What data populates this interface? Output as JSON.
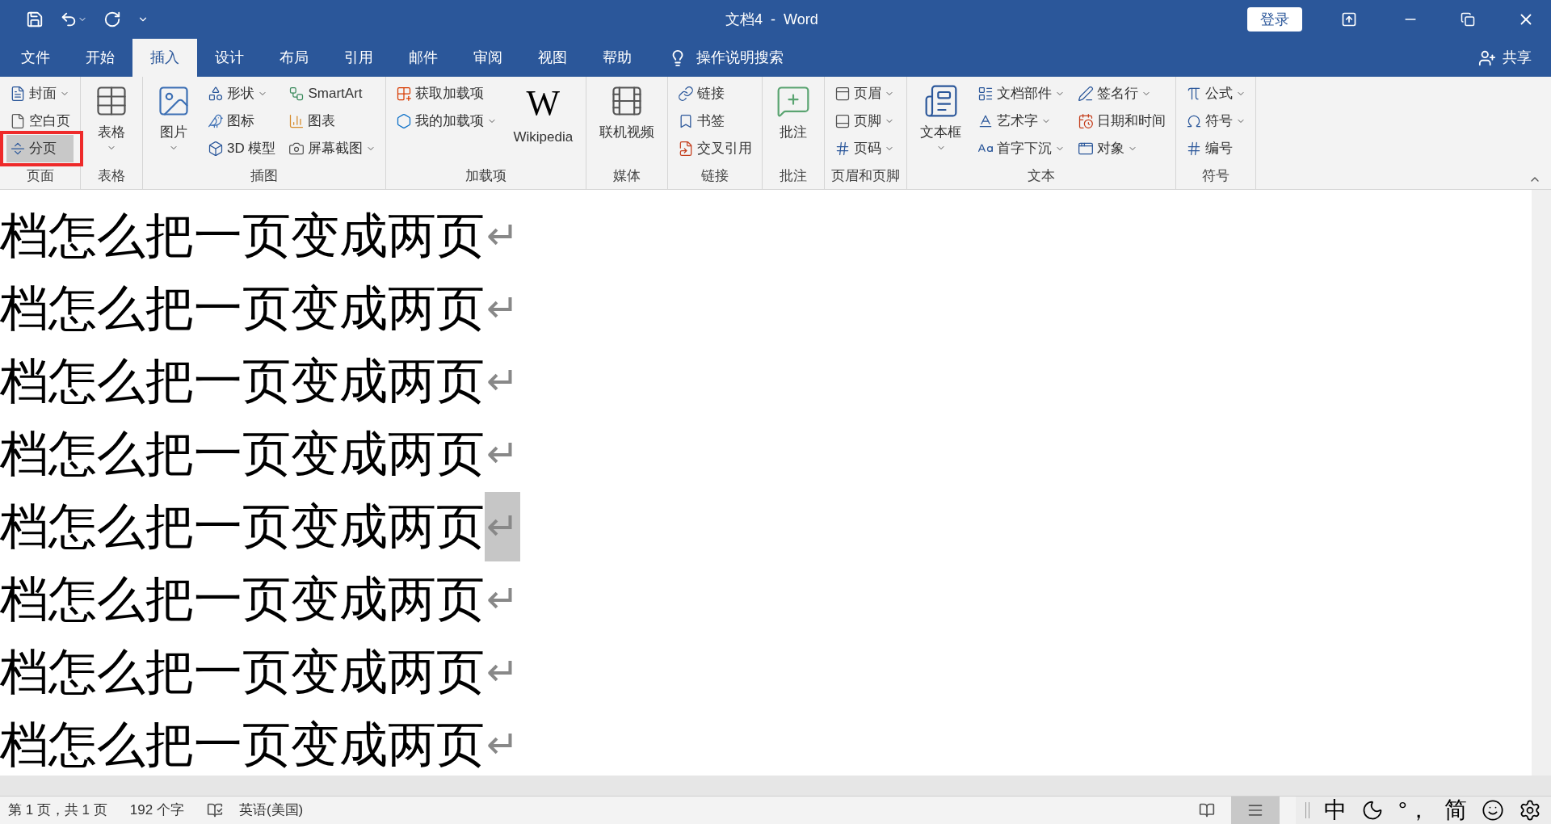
{
  "title_bar": {
    "title": "文档4  -  Word",
    "login": "登录"
  },
  "tabs": [
    {
      "label": "文件",
      "selected": false
    },
    {
      "label": "开始",
      "selected": false
    },
    {
      "label": "插入",
      "selected": true
    },
    {
      "label": "设计",
      "selected": false
    },
    {
      "label": "布局",
      "selected": false
    },
    {
      "label": "引用",
      "selected": false
    },
    {
      "label": "邮件",
      "selected": false
    },
    {
      "label": "审阅",
      "selected": false
    },
    {
      "label": "视图",
      "selected": false
    },
    {
      "label": "帮助",
      "selected": false
    }
  ],
  "tell_me": "操作说明搜索",
  "share": "共享",
  "ribbon": [
    {
      "label": "页面",
      "highlighted": true,
      "columns": [
        [
          {
            "label": "封面",
            "kind": "small",
            "dropdown": true,
            "selected": false
          },
          {
            "label": "空白页",
            "kind": "small",
            "dropdown": false,
            "selected": false
          },
          {
            "label": "分页",
            "kind": "small",
            "dropdown": false,
            "selected": true
          }
        ]
      ]
    },
    {
      "label": "表格",
      "columns": [
        [
          {
            "label": "表格",
            "kind": "large",
            "dropdown": true,
            "selected": false
          }
        ]
      ]
    },
    {
      "label": "插图",
      "columns": [
        [
          {
            "label": "图片",
            "kind": "large",
            "dropdown": true,
            "selected": false
          }
        ],
        [
          {
            "label": "形状",
            "kind": "small",
            "dropdown": true,
            "selected": false
          },
          {
            "label": "图标",
            "kind": "small",
            "dropdown": false,
            "selected": false
          },
          {
            "label": "3D 模型",
            "kind": "small",
            "dropdown": false,
            "selected": false
          }
        ],
        [
          {
            "label": "SmartArt",
            "kind": "small",
            "dropdown": false,
            "selected": false
          },
          {
            "label": "图表",
            "kind": "small",
            "dropdown": false,
            "selected": false
          },
          {
            "label": "屏幕截图",
            "kind": "small",
            "dropdown": true,
            "selected": false
          }
        ]
      ]
    },
    {
      "label": "加载项",
      "columns": [
        [
          {
            "label": "获取加载项",
            "kind": "small",
            "dropdown": false,
            "selected": false
          },
          {
            "label": "我的加载项",
            "kind": "small",
            "dropdown": true,
            "selected": false
          }
        ],
        [
          {
            "label": "Wikipedia",
            "kind": "logo",
            "glyph": "W",
            "dropdown": false,
            "selected": false
          }
        ]
      ]
    },
    {
      "label": "媒体",
      "columns": [
        [
          {
            "label": "联机视频",
            "kind": "large",
            "dropdown": false,
            "selected": false
          }
        ]
      ]
    },
    {
      "label": "链接",
      "columns": [
        [
          {
            "label": "链接",
            "kind": "small",
            "dropdown": false,
            "selected": false
          },
          {
            "label": "书签",
            "kind": "small",
            "dropdown": false,
            "selected": false
          },
          {
            "label": "交叉引用",
            "kind": "small",
            "dropdown": false,
            "selected": false
          }
        ]
      ]
    },
    {
      "label": "批注",
      "columns": [
        [
          {
            "label": "批注",
            "kind": "large",
            "dropdown": false,
            "selected": false
          }
        ]
      ]
    },
    {
      "label": "页眉和页脚",
      "columns": [
        [
          {
            "label": "页眉",
            "kind": "small",
            "dropdown": true,
            "selected": false
          },
          {
            "label": "页脚",
            "kind": "small",
            "dropdown": true,
            "selected": false
          },
          {
            "label": "页码",
            "kind": "small",
            "dropdown": true,
            "selected": false
          }
        ]
      ]
    },
    {
      "label": "文本",
      "columns": [
        [
          {
            "label": "文本框",
            "kind": "large",
            "dropdown": true,
            "selected": false
          }
        ],
        [
          {
            "label": "文档部件",
            "kind": "small",
            "dropdown": true,
            "selected": false
          },
          {
            "label": "艺术字",
            "kind": "small",
            "dropdown": true,
            "selected": false
          },
          {
            "label": "首字下沉",
            "kind": "small",
            "dropdown": true,
            "selected": false
          }
        ],
        [
          {
            "label": "签名行",
            "kind": "small",
            "dropdown": true,
            "selected": false
          },
          {
            "label": "日期和时间",
            "kind": "small",
            "dropdown": false,
            "selected": false
          },
          {
            "label": "对象",
            "kind": "small",
            "dropdown": true,
            "selected": false
          }
        ]
      ]
    },
    {
      "label": "符号",
      "columns": [
        [
          {
            "label": "公式",
            "kind": "small",
            "dropdown": true,
            "selected": false
          },
          {
            "label": "符号",
            "kind": "small",
            "dropdown": true,
            "selected": false
          },
          {
            "label": "编号",
            "kind": "small",
            "dropdown": false,
            "selected": false
          }
        ]
      ]
    }
  ],
  "document": [
    {
      "text": "档怎么把一页变成两页",
      "mark": "↵",
      "selected": false
    },
    {
      "text": "档怎么把一页变成两页",
      "mark": "↵",
      "selected": false
    },
    {
      "text": "档怎么把一页变成两页",
      "mark": "↵",
      "selected": false
    },
    {
      "text": "档怎么把一页变成两页",
      "mark": "↵",
      "selected": false
    },
    {
      "text": "档怎么把一页变成两页",
      "mark": "↵",
      "selected": true
    },
    {
      "text": "档怎么把一页变成两页",
      "mark": "↵",
      "selected": false
    },
    {
      "text": "档怎么把一页变成两页",
      "mark": "↵",
      "selected": false
    },
    {
      "text": "档怎么把一页变成两页",
      "mark": "↵",
      "selected": false
    }
  ],
  "status_bar": {
    "page": "第 1 页，共 1 页",
    "words": "192 个字",
    "language": "英语(美国)",
    "views": [
      {
        "selected": false
      },
      {
        "selected": true
      }
    ]
  },
  "ime": {
    "mode": "中",
    "punct": "°，",
    "script": "简"
  }
}
